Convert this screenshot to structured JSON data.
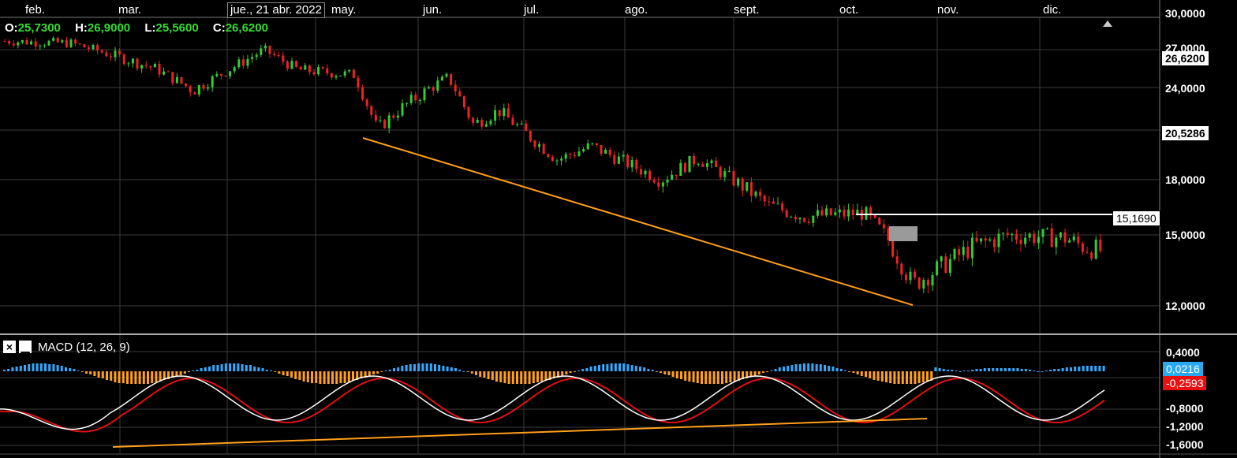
{
  "ohlc": {
    "open_label": "O:",
    "open": "25,7300",
    "high_label": "H:",
    "high": "26,9000",
    "low_label": "L:",
    "low": "25,5600",
    "close_label": "C:",
    "close": "26,6200"
  },
  "crosshair_date": "jue., 21 abr. 2022",
  "months": [
    "feb.",
    "mar.",
    "abr.",
    "may.",
    "jun.",
    "jul.",
    "ago.",
    "sept.",
    "oct.",
    "nov.",
    "dic."
  ],
  "price_axis": [
    "30,0000",
    "27,0000",
    "24,0000",
    "18,0000",
    "15,0000",
    "12,0000"
  ],
  "price_tags": {
    "last": "26,6200",
    "level": "20,5286",
    "resistance": "15,1690"
  },
  "macd": {
    "title": "MACD (12, 26, 9)",
    "close_button": "×",
    "minimize_button": "▁",
    "axis": [
      "0,4000",
      "-0,8000",
      "-1,2000",
      "-1,6000"
    ],
    "tag_hist": "0,0216",
    "tag_signal": "-0,2593"
  },
  "colors": {
    "up": "#33cc33",
    "down": "#ee2222",
    "trendline": "#ff9f1a",
    "hist_pos": "#33aaff",
    "hist_neg": "#ff9f1a",
    "macd_line": "#ffffff",
    "signal_line": "#e01010"
  },
  "chart_data": {
    "type": "candlestick",
    "months": [
      "feb.",
      "mar.",
      "abr.",
      "may.",
      "jun.",
      "jul.",
      "ago.",
      "sept.",
      "oct.",
      "nov.",
      "dic."
    ],
    "ylim": [
      11,
      30
    ],
    "close_path": [
      [
        "feb.",
        27.6
      ],
      [
        "mar.",
        25.5
      ],
      [
        "mar.",
        23.8
      ],
      [
        "abr.",
        27.0
      ],
      [
        "abr.",
        25.4
      ],
      [
        "may.",
        25.0
      ],
      [
        "may.",
        21.3
      ],
      [
        "may.",
        22.6
      ],
      [
        "jun.",
        24.8
      ],
      [
        "jun.",
        21.6
      ],
      [
        "jun.",
        22.5
      ],
      [
        "jul.",
        19.3
      ],
      [
        "jul.",
        20.2
      ],
      [
        "ago.",
        18.0
      ],
      [
        "ago.",
        19.4
      ],
      [
        "sept.",
        16.6
      ],
      [
        "sept.",
        16.0
      ],
      [
        "oct.",
        16.2
      ],
      [
        "oct.",
        14.8
      ],
      [
        "oct.",
        12.9
      ],
      [
        "nov.",
        14.5
      ],
      [
        "nov.",
        15.0
      ],
      [
        "dic.",
        14.9
      ],
      [
        "dic.",
        14.5
      ]
    ],
    "resistance_level": 15.169,
    "macd_axis": [
      0.4,
      -0.8,
      -1.2,
      -1.6
    ],
    "macd_last": 0.0216,
    "signal_last": -0.2593
  }
}
